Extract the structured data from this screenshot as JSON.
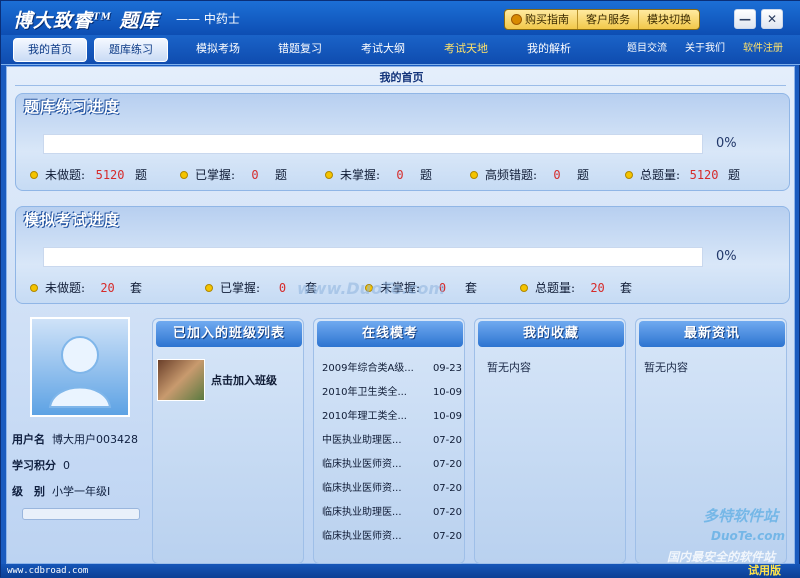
{
  "app": {
    "brand": "博大致睿",
    "tm": "TM",
    "brand_suffix": "题库",
    "subtitle": "—— 中药士",
    "title_buttons": [
      "购买指南",
      "客户服务",
      "模块切换"
    ],
    "win_min": "—",
    "win_close": "✕"
  },
  "nav": {
    "tabs": [
      "我的首页",
      "题库练习",
      "模拟考场",
      "错题复习",
      "考试大纲",
      "考试天地",
      "我的解析"
    ],
    "right_links": [
      "题目交流",
      "关于我们",
      "软件注册"
    ]
  },
  "page_title": "我的首页",
  "practice": {
    "title": "题库练习进度",
    "percent": "0%",
    "progress": 0,
    "stats": [
      {
        "label": "未做题:",
        "value": "5120",
        "unit": "题"
      },
      {
        "label": "已掌握:",
        "value": "0",
        "unit": "题"
      },
      {
        "label": "未掌握:",
        "value": "0",
        "unit": "题"
      },
      {
        "label": "高频错题:",
        "value": "0",
        "unit": "题"
      },
      {
        "label": "总题量:",
        "value": "5120",
        "unit": "题"
      }
    ]
  },
  "exam": {
    "title": "模拟考试进度",
    "percent": "0%",
    "progress": 0,
    "stats": [
      {
        "label": "未做题:",
        "value": "20",
        "unit": "套"
      },
      {
        "label": "已掌握:",
        "value": "0",
        "unit": "套"
      },
      {
        "label": "未掌握:",
        "value": "0",
        "unit": "套"
      },
      {
        "label": "总题量:",
        "value": "20",
        "unit": "套"
      }
    ]
  },
  "user": {
    "name_label": "用户名",
    "name": "博大用户003428",
    "points_label": "学习积分",
    "points": "0",
    "level_label": "级　别",
    "level": "小学一年级Ⅰ"
  },
  "classes": {
    "title": "已加入的班级列表",
    "join": "点击加入班级"
  },
  "online": {
    "title": "在线模考",
    "items": [
      {
        "name": "2009年综合类A级...",
        "date": "09-23"
      },
      {
        "name": "2010年卫生类全...",
        "date": "10-09"
      },
      {
        "name": "2010年理工类全...",
        "date": "10-09"
      },
      {
        "name": "中医执业助理医...",
        "date": "07-20"
      },
      {
        "name": "临床执业医师资...",
        "date": "07-20"
      },
      {
        "name": "临床执业医师资...",
        "date": "07-20"
      },
      {
        "name": "临床执业助理医...",
        "date": "07-20"
      },
      {
        "name": "临床执业医师资...",
        "date": "07-20"
      }
    ]
  },
  "favorites": {
    "title": "我的收藏",
    "empty": "暂无内容"
  },
  "news": {
    "title": "最新资讯",
    "empty": "暂无内容"
  },
  "status": {
    "site": "www.cdbroad.com",
    "trial": "试用版"
  },
  "watermark": {
    "text1": "www.DuoTe.com",
    "text2": "多特软件站",
    "text3": "DuoTe.com",
    "text4": "国内最安全的软件站"
  }
}
